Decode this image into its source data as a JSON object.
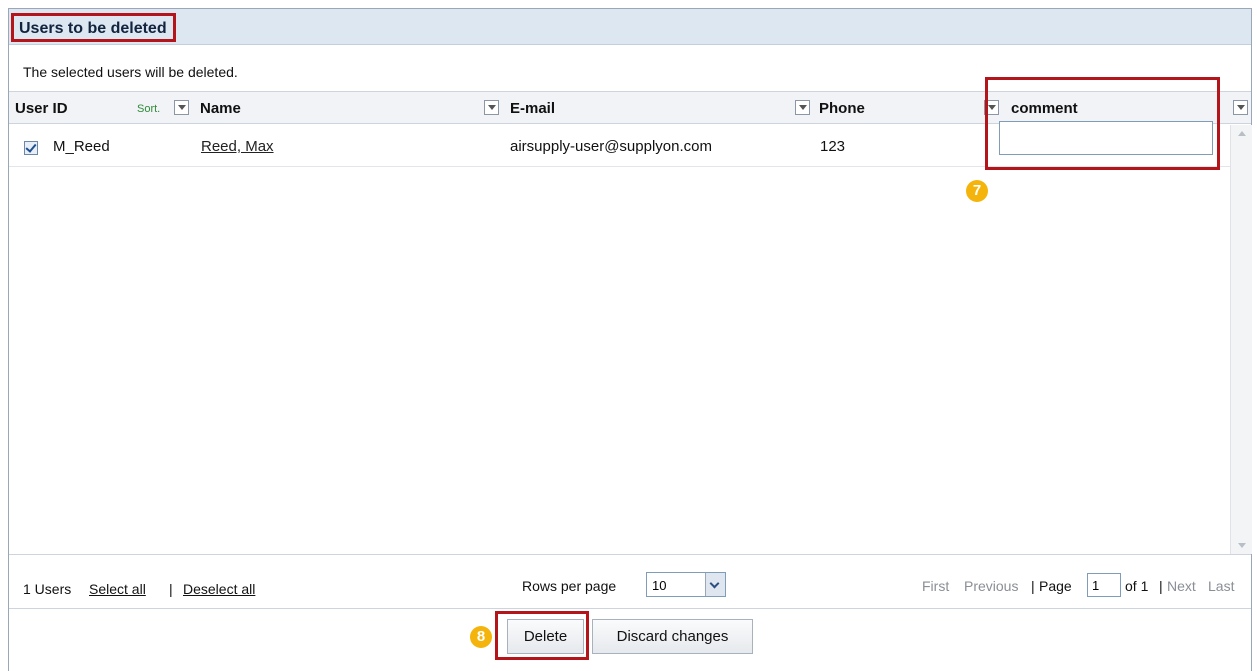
{
  "panel": {
    "title": "Users to be deleted",
    "description": "The selected users will be deleted."
  },
  "grid": {
    "columns": {
      "user_id": "User ID",
      "sort_label": "Sort.",
      "name": "Name",
      "email": "E-mail",
      "phone": "Phone",
      "comment": "comment"
    },
    "rows": [
      {
        "selected": true,
        "user_id": "M_Reed",
        "name": "Reed, Max",
        "email": "airsupply-user@supplyon.com",
        "phone": "123",
        "comment": ""
      }
    ]
  },
  "callouts": {
    "comment_marker": "7",
    "delete_marker": "8"
  },
  "footer": {
    "count_text": "1 Users",
    "select_all": "Select all",
    "separator": "|",
    "deselect_all": "Deselect all",
    "rows_per_page_label": "Rows per page",
    "rows_per_page_value": "10",
    "first": "First",
    "previous": "Previous",
    "page_sep": "|",
    "page_label": "Page",
    "page_value": "1",
    "of_text": "of 1",
    "page_sep2": "|",
    "next": "Next",
    "last": "Last"
  },
  "actions": {
    "delete": "Delete",
    "discard": "Discard changes"
  },
  "colors": {
    "highlight": "#b3151b",
    "header_bg": "#dde7f2",
    "marker": "#f4b40c"
  }
}
